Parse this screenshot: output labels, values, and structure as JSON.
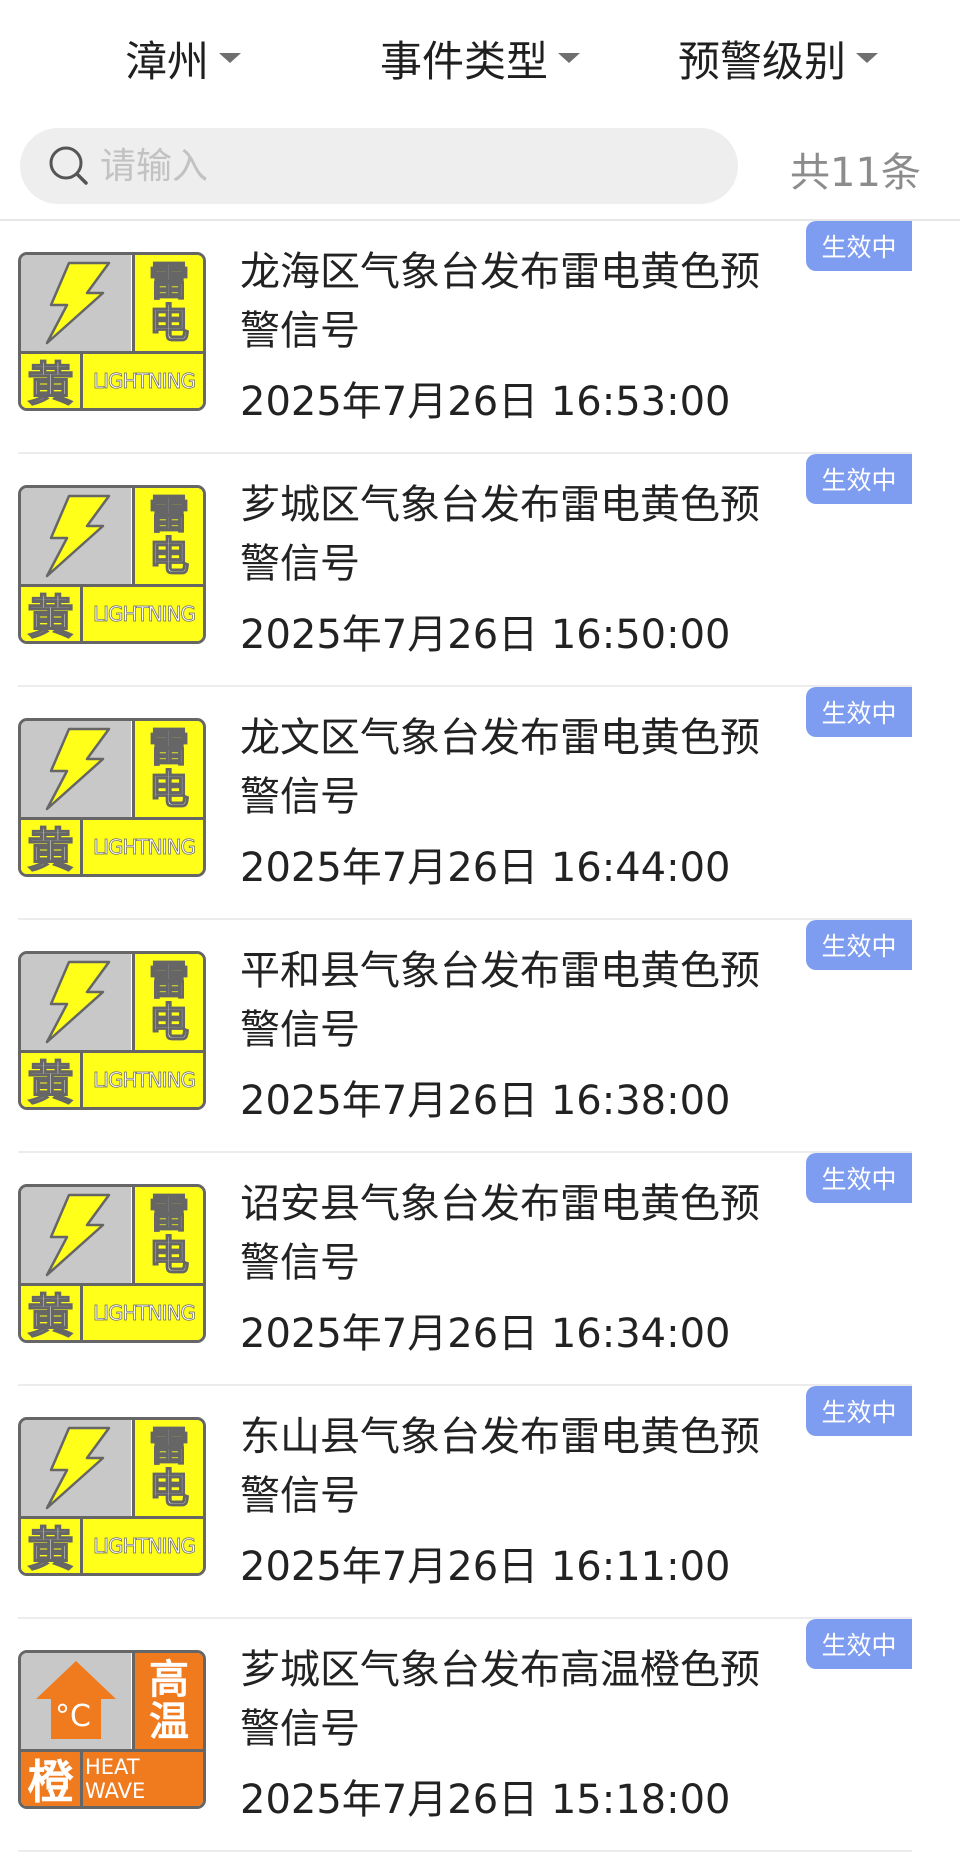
{
  "filters": {
    "region": "漳州",
    "event_type": "事件类型",
    "warning_level": "预警级别"
  },
  "search": {
    "placeholder": "请输入",
    "count_text": "共11条"
  },
  "colors": {
    "badge": "#7e9df0",
    "yellow_warning": "#ffff1a",
    "orange_warning": "#f07a1e"
  },
  "alerts": [
    {
      "title": "龙海区气象台发布雷电黄色预警信号",
      "time": "2025年7月26日 16:53:00",
      "status": "生效中",
      "icon": {
        "type": "lightning-icon",
        "cn_top": "雷",
        "cn_bottom": "电",
        "level": "黄",
        "en": "LIGHTNING"
      }
    },
    {
      "title": "芗城区气象台发布雷电黄色预警信号",
      "time": "2025年7月26日 16:50:00",
      "status": "生效中",
      "icon": {
        "type": "lightning-icon",
        "cn_top": "雷",
        "cn_bottom": "电",
        "level": "黄",
        "en": "LIGHTNING"
      }
    },
    {
      "title": "龙文区气象台发布雷电黄色预警信号",
      "time": "2025年7月26日 16:44:00",
      "status": "生效中",
      "icon": {
        "type": "lightning-icon",
        "cn_top": "雷",
        "cn_bottom": "电",
        "level": "黄",
        "en": "LIGHTNING"
      }
    },
    {
      "title": "平和县气象台发布雷电黄色预警信号",
      "time": "2025年7月26日 16:38:00",
      "status": "生效中",
      "icon": {
        "type": "lightning-icon",
        "cn_top": "雷",
        "cn_bottom": "电",
        "level": "黄",
        "en": "LIGHTNING"
      }
    },
    {
      "title": "诏安县气象台发布雷电黄色预警信号",
      "time": "2025年7月26日 16:34:00",
      "status": "生效中",
      "icon": {
        "type": "lightning-icon",
        "cn_top": "雷",
        "cn_bottom": "电",
        "level": "黄",
        "en": "LIGHTNING"
      }
    },
    {
      "title": "东山县气象台发布雷电黄色预警信号",
      "time": "2025年7月26日 16:11:00",
      "status": "生效中",
      "icon": {
        "type": "lightning-icon",
        "cn_top": "雷",
        "cn_bottom": "电",
        "level": "黄",
        "en": "LIGHTNING"
      }
    },
    {
      "title": "芗城区气象台发布高温橙色预警信号",
      "time": "2025年7月26日 15:18:00",
      "status": "生效中",
      "icon": {
        "type": "heat-wave-icon",
        "cn_top": "高",
        "cn_bottom": "温",
        "level": "橙",
        "en": "HEAT WAVE",
        "symbol": "°C"
      }
    }
  ]
}
